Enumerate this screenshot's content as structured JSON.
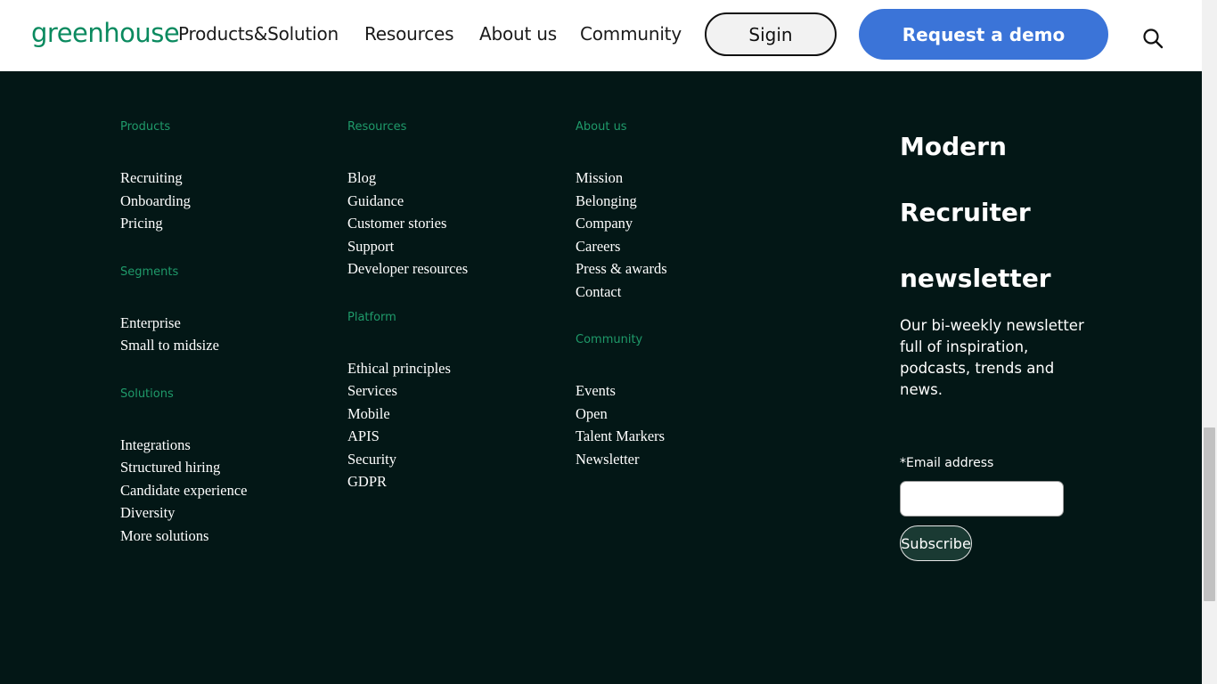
{
  "header": {
    "logo": "greenhouse",
    "nav": [
      {
        "label": "Products&Solution"
      },
      {
        "label": "Resources"
      },
      {
        "label": "About us"
      },
      {
        "label": "Community"
      }
    ],
    "signin_label": "Sigin",
    "demo_label": "Request a demo",
    "search_icon": "search-icon"
  },
  "footer": {
    "columns": [
      {
        "groups": [
          {
            "heading": "Products",
            "items": [
              "Recruiting",
              "Onboarding",
              "Pricing"
            ]
          },
          {
            "heading": "Segments",
            "items": [
              "Enterprise",
              "Small to midsize"
            ]
          },
          {
            "heading": "Solutions",
            "items": [
              "Integrations",
              "Structured hiring",
              "Candidate experience",
              "Diversity",
              "More solutions"
            ]
          }
        ]
      },
      {
        "groups": [
          {
            "heading": "Resources",
            "items": [
              "Blog",
              "Guidance",
              "Customer stories",
              "Support",
              "Developer resources"
            ]
          },
          {
            "heading": "Platform",
            "items": [
              "Ethical principles",
              "Services",
              "Mobile",
              "APIS",
              "Security",
              "GDPR"
            ]
          }
        ]
      },
      {
        "groups": [
          {
            "heading": "About us",
            "items": [
              "Mission",
              "Belonging",
              "Company",
              "Careers",
              "Press & awards",
              "Contact"
            ]
          },
          {
            "heading": "Community",
            "items": [
              "Events",
              "Open",
              "Talent Markers",
              "Newsletter"
            ]
          }
        ]
      }
    ]
  },
  "newsletter": {
    "title_lines": [
      "Modern",
      "Recruiter",
      "newsletter"
    ],
    "description": "Our bi-weekly newsletter full of inspiration, podcasts, trends and news.",
    "email_label": "*Email address",
    "email_value": "",
    "subscribe_label": "Subscribe"
  },
  "colors": {
    "background": "#031716",
    "accent_green": "#1f9a6a",
    "demo_blue": "#3b74d8",
    "logo_green": "#0a8a5f"
  }
}
